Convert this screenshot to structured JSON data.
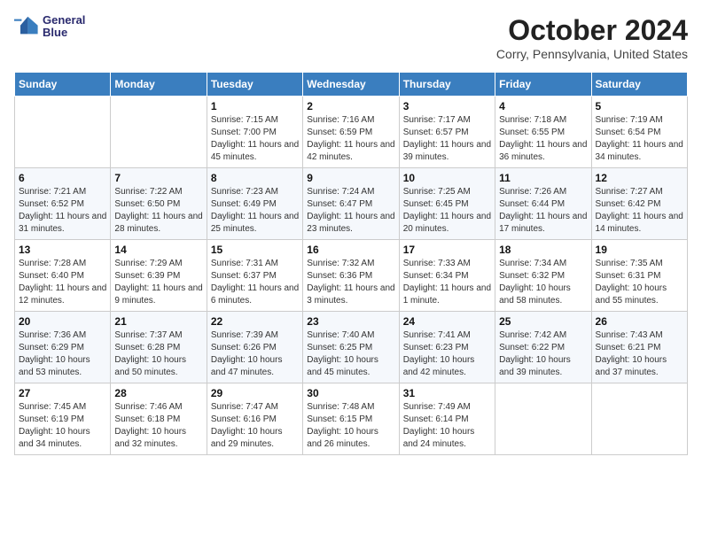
{
  "header": {
    "logo_line1": "General",
    "logo_line2": "Blue",
    "month": "October 2024",
    "location": "Corry, Pennsylvania, United States"
  },
  "weekdays": [
    "Sunday",
    "Monday",
    "Tuesday",
    "Wednesday",
    "Thursday",
    "Friday",
    "Saturday"
  ],
  "weeks": [
    [
      {
        "day": "",
        "info": ""
      },
      {
        "day": "",
        "info": ""
      },
      {
        "day": "1",
        "info": "Sunrise: 7:15 AM\nSunset: 7:00 PM\nDaylight: 11 hours and 45 minutes."
      },
      {
        "day": "2",
        "info": "Sunrise: 7:16 AM\nSunset: 6:59 PM\nDaylight: 11 hours and 42 minutes."
      },
      {
        "day": "3",
        "info": "Sunrise: 7:17 AM\nSunset: 6:57 PM\nDaylight: 11 hours and 39 minutes."
      },
      {
        "day": "4",
        "info": "Sunrise: 7:18 AM\nSunset: 6:55 PM\nDaylight: 11 hours and 36 minutes."
      },
      {
        "day": "5",
        "info": "Sunrise: 7:19 AM\nSunset: 6:54 PM\nDaylight: 11 hours and 34 minutes."
      }
    ],
    [
      {
        "day": "6",
        "info": "Sunrise: 7:21 AM\nSunset: 6:52 PM\nDaylight: 11 hours and 31 minutes."
      },
      {
        "day": "7",
        "info": "Sunrise: 7:22 AM\nSunset: 6:50 PM\nDaylight: 11 hours and 28 minutes."
      },
      {
        "day": "8",
        "info": "Sunrise: 7:23 AM\nSunset: 6:49 PM\nDaylight: 11 hours and 25 minutes."
      },
      {
        "day": "9",
        "info": "Sunrise: 7:24 AM\nSunset: 6:47 PM\nDaylight: 11 hours and 23 minutes."
      },
      {
        "day": "10",
        "info": "Sunrise: 7:25 AM\nSunset: 6:45 PM\nDaylight: 11 hours and 20 minutes."
      },
      {
        "day": "11",
        "info": "Sunrise: 7:26 AM\nSunset: 6:44 PM\nDaylight: 11 hours and 17 minutes."
      },
      {
        "day": "12",
        "info": "Sunrise: 7:27 AM\nSunset: 6:42 PM\nDaylight: 11 hours and 14 minutes."
      }
    ],
    [
      {
        "day": "13",
        "info": "Sunrise: 7:28 AM\nSunset: 6:40 PM\nDaylight: 11 hours and 12 minutes."
      },
      {
        "day": "14",
        "info": "Sunrise: 7:29 AM\nSunset: 6:39 PM\nDaylight: 11 hours and 9 minutes."
      },
      {
        "day": "15",
        "info": "Sunrise: 7:31 AM\nSunset: 6:37 PM\nDaylight: 11 hours and 6 minutes."
      },
      {
        "day": "16",
        "info": "Sunrise: 7:32 AM\nSunset: 6:36 PM\nDaylight: 11 hours and 3 minutes."
      },
      {
        "day": "17",
        "info": "Sunrise: 7:33 AM\nSunset: 6:34 PM\nDaylight: 11 hours and 1 minute."
      },
      {
        "day": "18",
        "info": "Sunrise: 7:34 AM\nSunset: 6:32 PM\nDaylight: 10 hours and 58 minutes."
      },
      {
        "day": "19",
        "info": "Sunrise: 7:35 AM\nSunset: 6:31 PM\nDaylight: 10 hours and 55 minutes."
      }
    ],
    [
      {
        "day": "20",
        "info": "Sunrise: 7:36 AM\nSunset: 6:29 PM\nDaylight: 10 hours and 53 minutes."
      },
      {
        "day": "21",
        "info": "Sunrise: 7:37 AM\nSunset: 6:28 PM\nDaylight: 10 hours and 50 minutes."
      },
      {
        "day": "22",
        "info": "Sunrise: 7:39 AM\nSunset: 6:26 PM\nDaylight: 10 hours and 47 minutes."
      },
      {
        "day": "23",
        "info": "Sunrise: 7:40 AM\nSunset: 6:25 PM\nDaylight: 10 hours and 45 minutes."
      },
      {
        "day": "24",
        "info": "Sunrise: 7:41 AM\nSunset: 6:23 PM\nDaylight: 10 hours and 42 minutes."
      },
      {
        "day": "25",
        "info": "Sunrise: 7:42 AM\nSunset: 6:22 PM\nDaylight: 10 hours and 39 minutes."
      },
      {
        "day": "26",
        "info": "Sunrise: 7:43 AM\nSunset: 6:21 PM\nDaylight: 10 hours and 37 minutes."
      }
    ],
    [
      {
        "day": "27",
        "info": "Sunrise: 7:45 AM\nSunset: 6:19 PM\nDaylight: 10 hours and 34 minutes."
      },
      {
        "day": "28",
        "info": "Sunrise: 7:46 AM\nSunset: 6:18 PM\nDaylight: 10 hours and 32 minutes."
      },
      {
        "day": "29",
        "info": "Sunrise: 7:47 AM\nSunset: 6:16 PM\nDaylight: 10 hours and 29 minutes."
      },
      {
        "day": "30",
        "info": "Sunrise: 7:48 AM\nSunset: 6:15 PM\nDaylight: 10 hours and 26 minutes."
      },
      {
        "day": "31",
        "info": "Sunrise: 7:49 AM\nSunset: 6:14 PM\nDaylight: 10 hours and 24 minutes."
      },
      {
        "day": "",
        "info": ""
      },
      {
        "day": "",
        "info": ""
      }
    ]
  ]
}
